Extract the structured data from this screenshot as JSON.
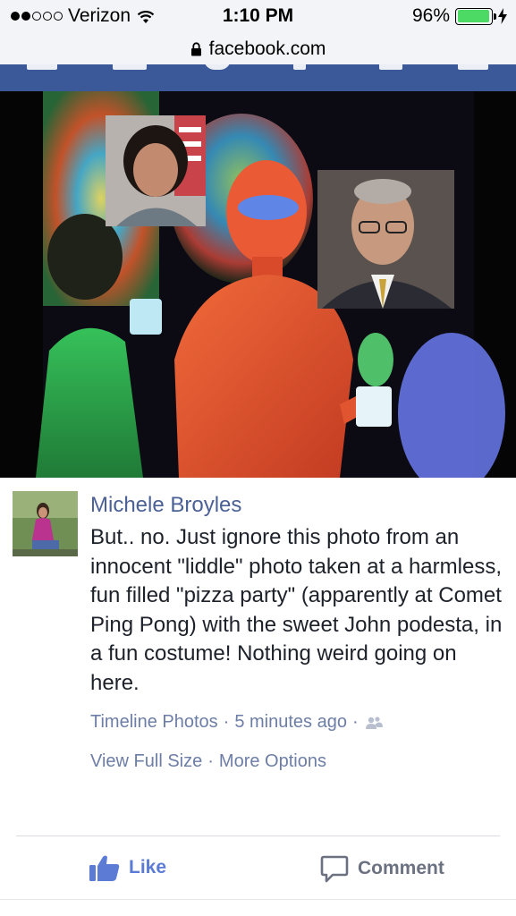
{
  "status_bar": {
    "carrier": "Verizon",
    "time": "1:10 PM",
    "battery_percent": "96%",
    "signal_bars_filled": 2,
    "signal_bars_total": 5,
    "icons": [
      "wifi-icon",
      "battery-icon",
      "charging-bolt-icon"
    ]
  },
  "url_bar": {
    "url": "facebook.com",
    "icon": "lock-icon"
  },
  "nav": {
    "background_color": "#3b5998"
  },
  "photo": {
    "description_icon": "photo"
  },
  "post": {
    "author": "Michele Broyles",
    "text": "But.. no. Just ignore this photo from an innocent \"liddle\" photo taken at a harmless, fun filled \"pizza party\" (apparently at Comet Ping Pong) with the sweet John podesta, in a fun costume! Nothing weird going on here.",
    "meta": {
      "album": "Timeline Photos",
      "sep1": "·",
      "time_ago": "5 minutes ago",
      "sep2": "·",
      "audience_icon": "friends-icon"
    },
    "links": {
      "view_full_size": "View Full Size",
      "sep": "·",
      "more_options": "More Options"
    }
  },
  "actions": {
    "like_label": "Like",
    "comment_label": "Comment",
    "like_color": "#5b7bd5",
    "comment_color": "#6b7180"
  }
}
